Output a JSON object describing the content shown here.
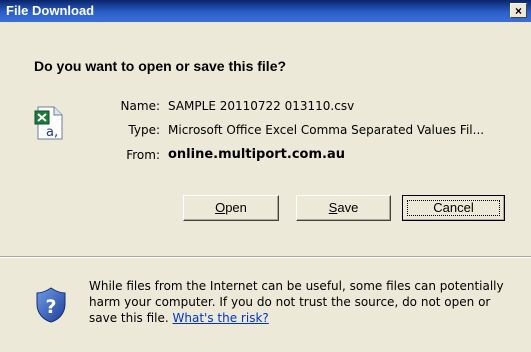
{
  "dialog": {
    "title": "File Download",
    "close_label": "×",
    "question": "Do you want to open or save this file?"
  },
  "file": {
    "name_label": "Name:",
    "name": "SAMPLE 20110722 013110.csv",
    "type_label": "Type:",
    "type": "Microsoft Office Excel Comma Separated Values Fil...",
    "from_label": "From:",
    "from": "online.multiport.com.au",
    "icon": "excel-csv-icon"
  },
  "buttons": {
    "open": {
      "before": "",
      "key": "O",
      "after": "pen"
    },
    "save": {
      "before": "",
      "key": "S",
      "after": "ave"
    },
    "cancel": "Cancel"
  },
  "warning": {
    "text": "While files from the Internet can be useful, some files can potentially harm your computer. If you do not trust the source, do not open or save this file. ",
    "link": "What's the risk?",
    "icon": "security-shield-icon"
  }
}
